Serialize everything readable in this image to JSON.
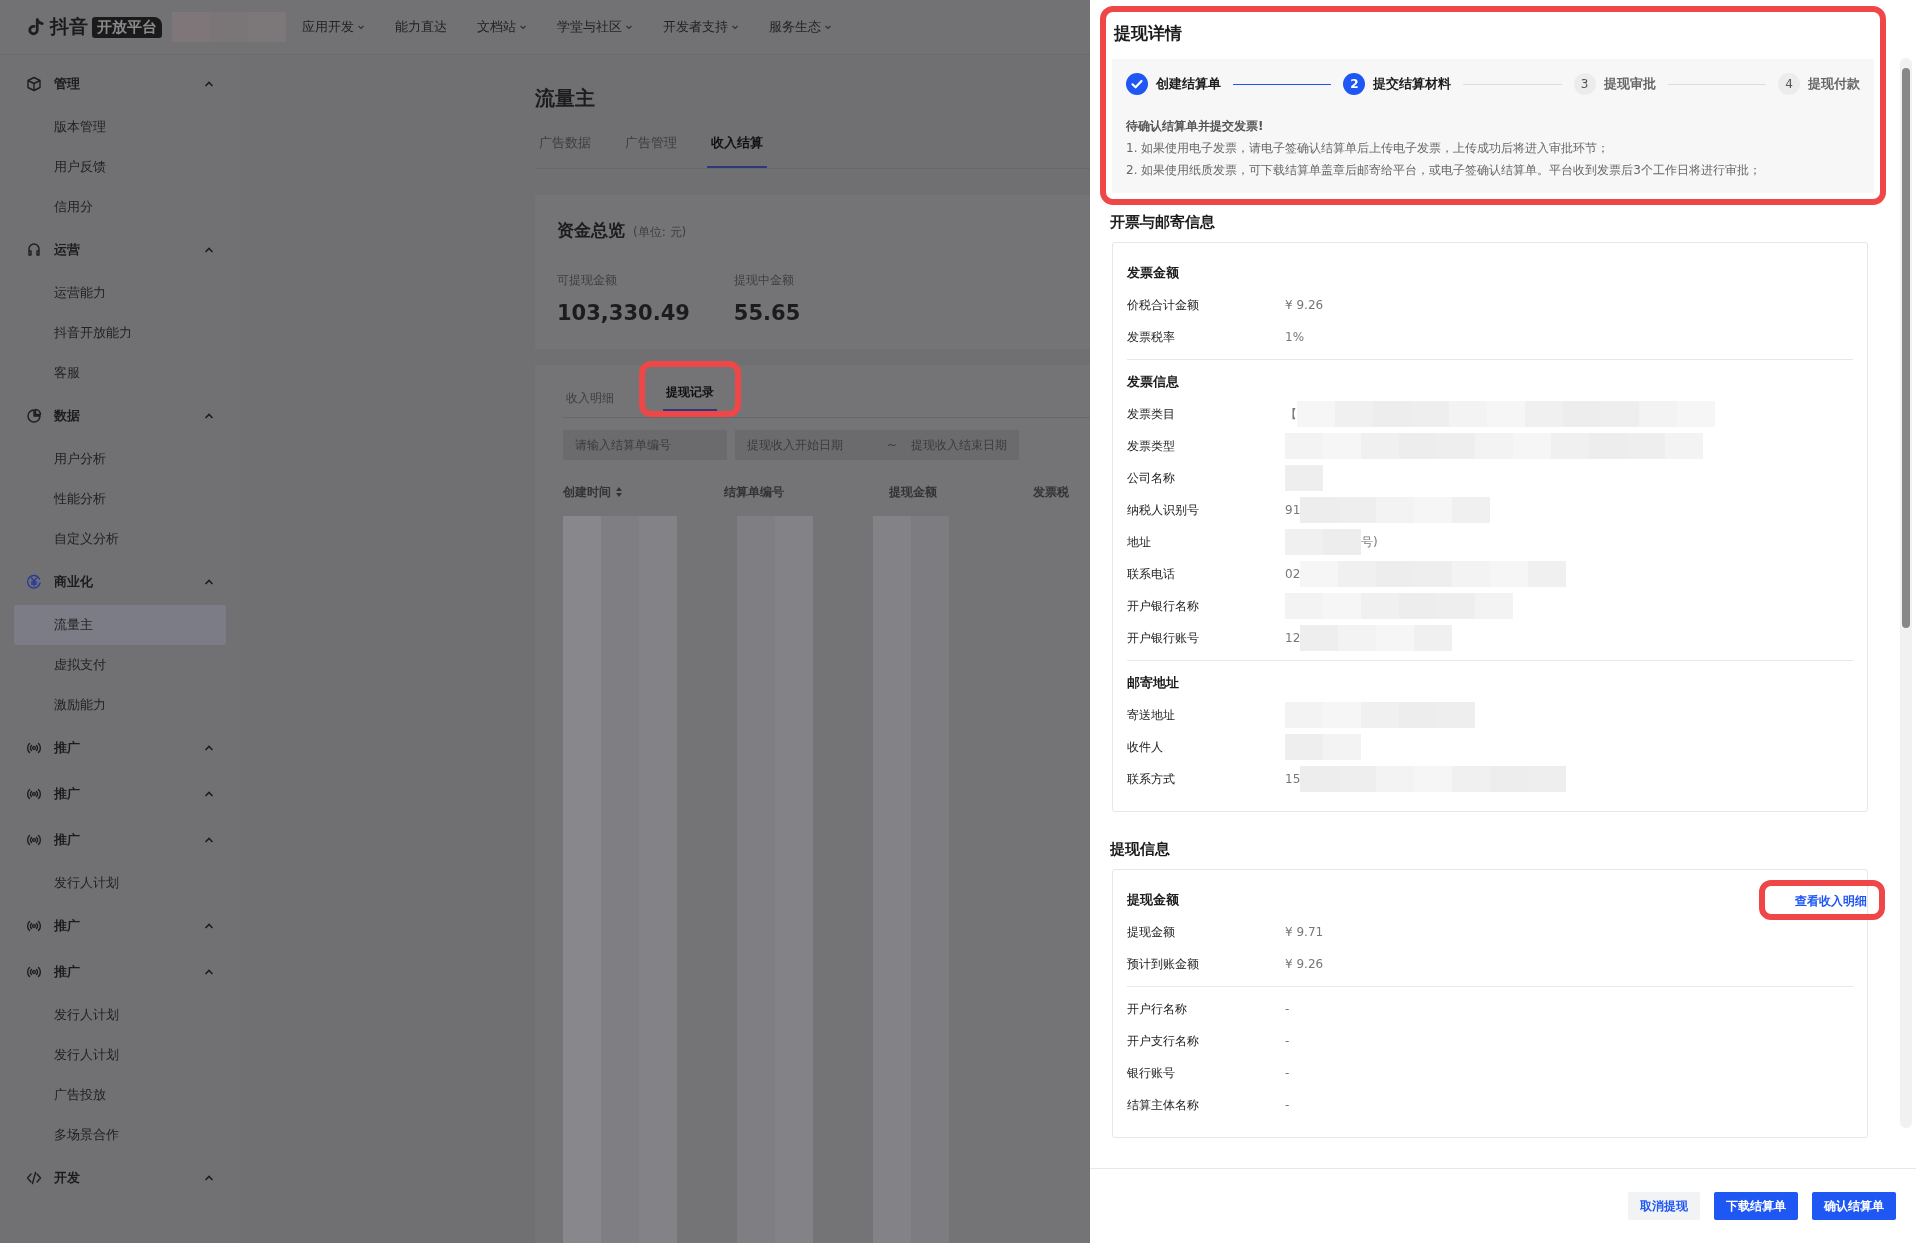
{
  "top_nav": {
    "logo_text": "抖音",
    "logo_badge": "开放平台",
    "items": [
      {
        "label": "应用开发",
        "dropdown": true
      },
      {
        "label": "能力直达",
        "dropdown": false
      },
      {
        "label": "文档站",
        "dropdown": true
      },
      {
        "label": "学堂与社区",
        "dropdown": true
      },
      {
        "label": "开发者支持",
        "dropdown": true
      },
      {
        "label": "服务生态",
        "dropdown": true
      }
    ]
  },
  "sidebar": {
    "groups": [
      {
        "label": "管理",
        "expanded": true,
        "children": [
          {
            "label": "版本管理",
            "selected": false
          },
          {
            "label": "用户反馈",
            "selected": false
          },
          {
            "label": "信用分",
            "selected": false
          }
        ]
      },
      {
        "label": "运营",
        "expanded": true,
        "children": [
          {
            "label": "运营能力",
            "selected": false
          },
          {
            "label": "抖音开放能力",
            "selected": false
          },
          {
            "label": "客服",
            "selected": false
          }
        ]
      },
      {
        "label": "数据",
        "expanded": true,
        "children": [
          {
            "label": "用户分析",
            "selected": false
          },
          {
            "label": "性能分析",
            "selected": false
          },
          {
            "label": "自定义分析",
            "selected": false
          }
        ]
      },
      {
        "label": "商业化",
        "expanded": true,
        "children": [
          {
            "label": "流量主",
            "selected": true
          },
          {
            "label": "虚拟支付",
            "selected": false
          },
          {
            "label": "激励能力",
            "selected": false
          }
        ]
      },
      {
        "label": "推广",
        "expanded": true
      },
      {
        "label": "推广",
        "expanded": true
      },
      {
        "label": "推广",
        "expanded": true,
        "children": [
          {
            "label": "发行人计划",
            "selected": false
          }
        ]
      },
      {
        "label": "推广",
        "expanded": true
      },
      {
        "label": "推广",
        "expanded": true,
        "children": [
          {
            "label": "发行人计划",
            "selected": false
          },
          {
            "label": "发行人计划",
            "selected": false
          },
          {
            "label": "广告投放",
            "selected": false
          },
          {
            "label": "多场景合作",
            "selected": false
          }
        ]
      },
      {
        "label": "开发",
        "expanded": true
      }
    ]
  },
  "main": {
    "title": "流量主",
    "tabs": [
      {
        "label": "广告数据",
        "selected": false
      },
      {
        "label": "广告管理",
        "selected": false
      },
      {
        "label": "收入结算",
        "selected": true
      }
    ],
    "overview": {
      "title": "资金总览",
      "unit": "(单位: 元)",
      "stats": [
        {
          "label": "可提现金额",
          "value": "103,330.49"
        },
        {
          "label": "提现中金额",
          "value": "55.65"
        }
      ]
    },
    "subtabs": [
      {
        "label": "收入明细",
        "selected": false
      },
      {
        "label": "提现记录",
        "selected": true,
        "highlighted": true
      }
    ],
    "filters": {
      "search_placeholder": "请输入结算单编号",
      "start_placeholder": "提现收入开始日期",
      "separator": "~",
      "end_placeholder": "提现收入结束日期"
    },
    "table": {
      "columns": [
        {
          "label": "创建时间",
          "sortable": true
        },
        {
          "label": "结算单编号",
          "sortable": false
        },
        {
          "label": "提现金额",
          "sortable": false
        },
        {
          "label": "发票税",
          "sortable": false
        }
      ]
    }
  },
  "drawer": {
    "title": "提现详情",
    "steps": [
      {
        "label": "创建结算单",
        "kind": "done"
      },
      {
        "number": "2",
        "label": "提交结算材料",
        "kind": "current"
      },
      {
        "number": "3",
        "label": "提现审批",
        "kind": "wait"
      },
      {
        "number": "4",
        "label": "提现付款",
        "kind": "wait"
      }
    ],
    "notice": {
      "title": "待确认结算单并提交发票!",
      "lines": [
        "1. 如果使用电子发票，请电子签确认结算单后上传电子发票，上传成功后将进入审批环节；",
        "2. 如果使用纸质发票，可下载结算单盖章后邮寄给平台，或电子签确认结算单。平台收到发票后3个工作日将进行审批；"
      ]
    },
    "sections": [
      {
        "title": "开票与邮寄信息",
        "groups": [
          {
            "title": "发票金额",
            "rows": [
              {
                "label": "价税合计金额",
                "value": "¥ 9.26",
                "redacted": false
              },
              {
                "label": "发票税率",
                "value": "1%",
                "redacted": false
              }
            ]
          },
          {
            "title": "发票信息",
            "rows": [
              {
                "label": "发票类目",
                "value": "【",
                "redacted": true
              },
              {
                "label": "发票类型",
                "redacted": true
              },
              {
                "label": "公司名称",
                "redacted": true
              },
              {
                "label": "纳税人识别号",
                "value": "91",
                "redacted": true
              },
              {
                "label": "地址",
                "redacted": true,
                "value_end": "号)"
              },
              {
                "label": "联系电话",
                "value": "02",
                "redacted": true
              },
              {
                "label": "开户银行名称",
                "redacted": true
              },
              {
                "label": "开户银行账号",
                "value": "12",
                "redacted": true
              }
            ]
          },
          {
            "title": "邮寄地址",
            "rows": [
              {
                "label": "寄送地址",
                "redacted": true
              },
              {
                "label": "收件人",
                "redacted": true
              },
              {
                "label": "联系方式",
                "value": "15",
                "redacted": true
              }
            ]
          }
        ]
      },
      {
        "title": "提现信息",
        "groups": [
          {
            "title": "提现金额",
            "link": "查看收入明细",
            "rows": [
              {
                "label": "提现金额",
                "value": "¥ 9.71",
                "redacted": false
              },
              {
                "label": "预计到账金额",
                "value": "¥ 9.26",
                "redacted": false
              }
            ]
          },
          {
            "rows": [
              {
                "label": "开户行名称",
                "value": "-",
                "redacted": false
              },
              {
                "label": "开户支行名称",
                "value": "-",
                "redacted": false
              },
              {
                "label": "银行账号",
                "value": "-",
                "redacted": false
              },
              {
                "label": "结算主体名称",
                "value": "-",
                "redacted": false
              }
            ]
          }
        ]
      }
    ],
    "buttons": [
      {
        "label": "取消提现",
        "kind": "secondary"
      },
      {
        "label": "下载结算单",
        "kind": "primary"
      },
      {
        "label": "确认结算单",
        "kind": "primary"
      }
    ]
  }
}
